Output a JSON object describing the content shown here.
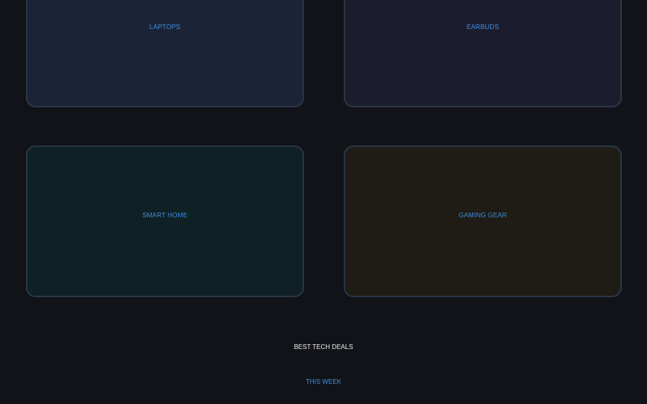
{
  "categories": [
    {
      "id": "laptops",
      "label": "LAPTOPS"
    },
    {
      "id": "earbuds",
      "label": "EARBUDS"
    },
    {
      "id": "smart_home",
      "label": "SMART HOME"
    },
    {
      "id": "gaming_gear",
      "label": "GAMING GEAR"
    }
  ],
  "footer": {
    "title": "BEST TECH DEALS",
    "subtitle": "THIS WEEK"
  },
  "colors": {
    "background": "#111318",
    "accent": "#3f8de0",
    "title_text": "#e8e8ea",
    "card_border": "#2a3544"
  }
}
